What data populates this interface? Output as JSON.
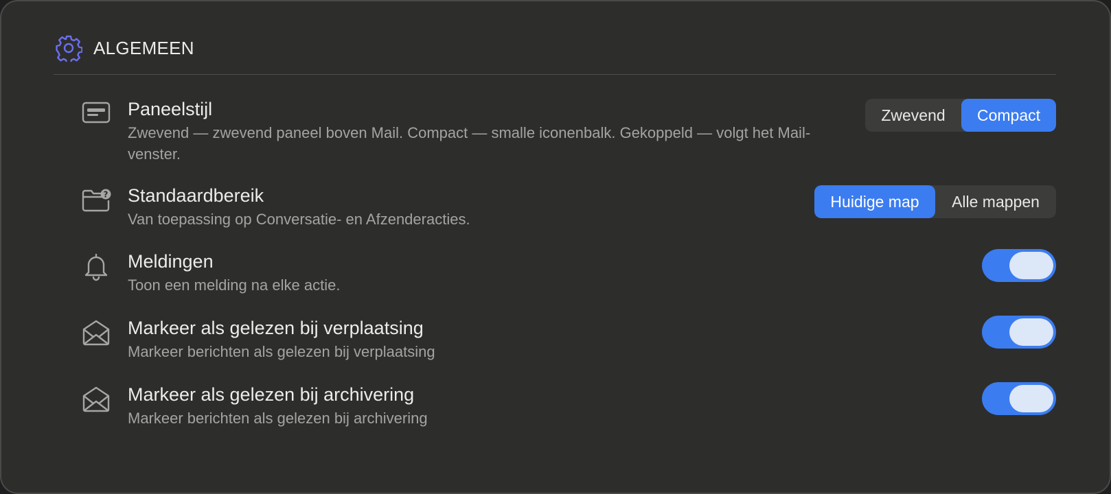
{
  "section": {
    "title": "ALGEMEEN",
    "icon": "gear-icon",
    "accent": "#6b6ff0"
  },
  "settings": [
    {
      "icon": "panel-card-icon",
      "title": "Paneelstijl",
      "description": "Zwevend — zwevend paneel boven Mail. Compact — smalle iconenbalk. Gekoppeld — volgt het Mail-venster.",
      "control": "segmented",
      "options": [
        "Zwevend",
        "Compact"
      ],
      "selected": "Compact"
    },
    {
      "icon": "folder-question-icon",
      "title": "Standaardbereik",
      "description": "Van toepassing op Conversatie- en Afzenderacties.",
      "control": "segmented",
      "options": [
        "Huidige map",
        "Alle mappen"
      ],
      "selected": "Huidige map"
    },
    {
      "icon": "bell-icon",
      "title": "Meldingen",
      "description": "Toon een melding na elke actie.",
      "control": "toggle",
      "on": true
    },
    {
      "icon": "envelope-open-icon",
      "title": "Markeer als gelezen bij verplaatsing",
      "description": "Markeer berichten als gelezen bij verplaatsing",
      "control": "toggle",
      "on": true
    },
    {
      "icon": "envelope-open-icon",
      "title": "Markeer als gelezen bij archivering",
      "description": "Markeer berichten als gelezen bij archivering",
      "control": "toggle",
      "on": true
    }
  ],
  "colors": {
    "accent_blue": "#3b7cf0",
    "panel_bg": "#2d2d2c",
    "segment_bg": "#3c3c3b",
    "toggle_knob": "#dce7f7"
  }
}
